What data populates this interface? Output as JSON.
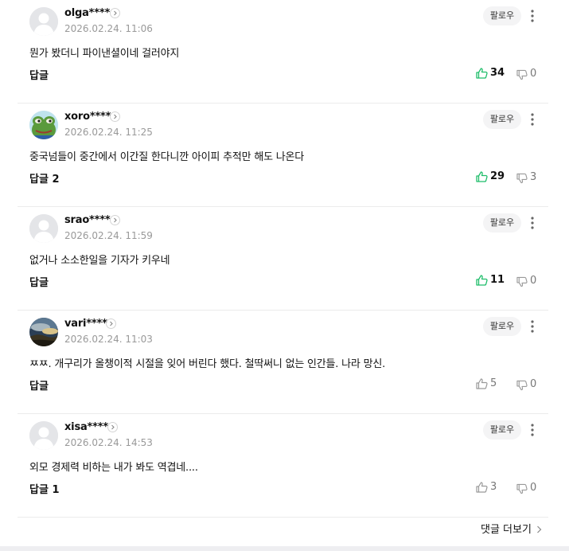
{
  "colors": {
    "like_active": "#1fbd6a",
    "icon_gray": "#999999",
    "follow_bg": "#f4f4f5",
    "divider": "#ebebeb"
  },
  "comments": [
    {
      "username": "olga****",
      "date": "2026.02.24. 11:06",
      "text": "뭔가 봤더니 파이낸셜이네 걸러야지",
      "reply_label": "답글",
      "follow_label": "팔로우",
      "likes": "34",
      "dislikes": "0",
      "liked_style": "active",
      "avatar": "default-avatar"
    },
    {
      "username": "xoro****",
      "date": "2026.02.24. 11:25",
      "text": "중국넘들이 중간에서 이간질 한다니깐 아이피 추적만 해도 나온다",
      "reply_label": "답글 2",
      "follow_label": "팔로우",
      "likes": "29",
      "dislikes": "3",
      "liked_style": "active",
      "avatar": "frog-avatar"
    },
    {
      "username": "srao****",
      "date": "2026.02.24. 11:59",
      "text": "없거나 소소한일을 기자가 키우네",
      "reply_label": "답글",
      "follow_label": "팔로우",
      "likes": "11",
      "dislikes": "0",
      "liked_style": "active",
      "avatar": "default-avatar"
    },
    {
      "username": "vari****",
      "date": "2026.02.24. 11:03",
      "text": "ㅉㅉ. 개구리가 올챙이적 시절을 잊어 버린다 했다. 철딱써니 없는 인간들. 나라 망신.",
      "reply_label": "답글",
      "follow_label": "팔로우",
      "likes": "5",
      "dislikes": "0",
      "liked_style": "inactive",
      "avatar": "landscape-avatar"
    },
    {
      "username": "xisa****",
      "date": "2026.02.24. 14:53",
      "text": "외모 경제력 비하는 내가 봐도 역겹네....",
      "reply_label": "답글 1",
      "follow_label": "팔로우",
      "likes": "3",
      "dislikes": "0",
      "liked_style": "inactive",
      "avatar": "default-avatar"
    }
  ],
  "more_comments_label": "댓글 더보기"
}
